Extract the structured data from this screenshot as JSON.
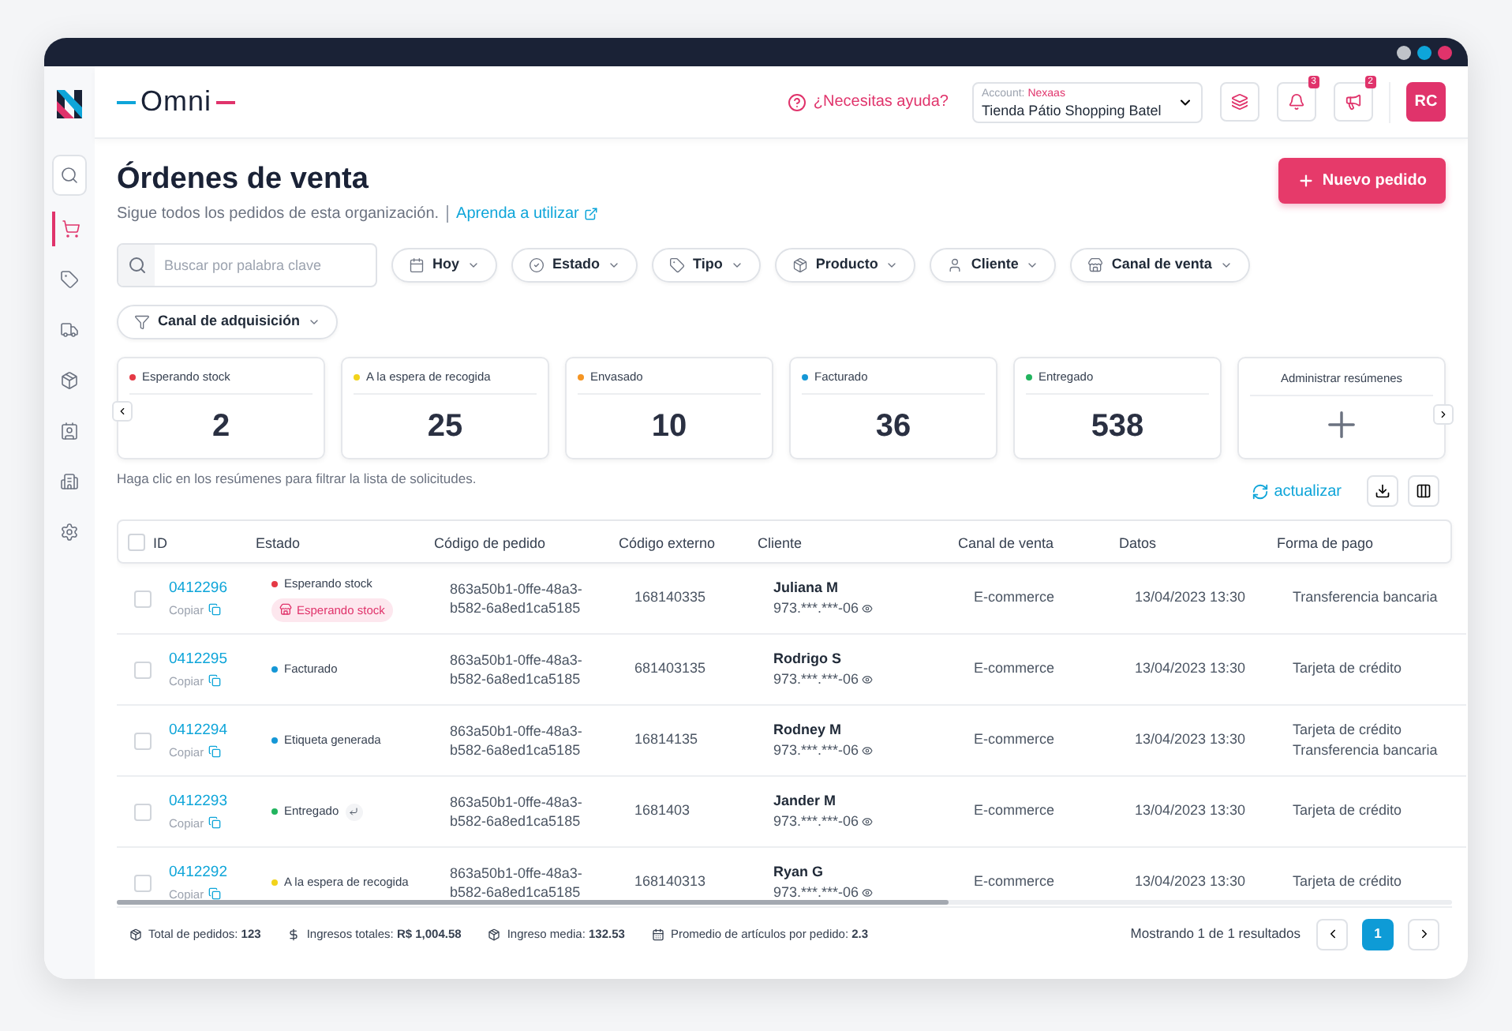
{
  "window": {
    "controls": [
      {
        "color": "#bfc3c9"
      },
      {
        "color": "#0ea5d9"
      },
      {
        "color": "#e0336b"
      }
    ]
  },
  "sidebar": {
    "items": [
      {
        "kind": "search",
        "selected": false
      },
      {
        "kind": "cart",
        "selected": true
      },
      {
        "kind": "tag",
        "selected": false
      },
      {
        "kind": "truck",
        "selected": false
      },
      {
        "kind": "box",
        "selected": false
      },
      {
        "kind": "contact",
        "selected": false
      },
      {
        "kind": "building",
        "selected": false
      },
      {
        "kind": "settings",
        "selected": false
      }
    ]
  },
  "header": {
    "brand": "Omni",
    "help": "¿Necesitas ayuda?",
    "account": {
      "label": "Account:",
      "name": "Nexaas",
      "store": "Tienda Pátio Shopping Batel"
    },
    "icons": [
      {
        "kind": "layers"
      },
      {
        "kind": "bell",
        "badge": "3"
      },
      {
        "kind": "megaphone",
        "badge": "2"
      }
    ],
    "avatar": "RC"
  },
  "page": {
    "title": "Órdenes de venta",
    "subtitle": "Sigue todos los pedidos de esta organización.",
    "learn_link": "Aprenda a utilizar",
    "new_button": "Nuevo pedido"
  },
  "search": {
    "placeholder": "Buscar por palabra clave"
  },
  "filters": [
    {
      "kind": "calendar",
      "label": "Hoy"
    },
    {
      "kind": "status",
      "label": "Estado"
    },
    {
      "kind": "tag",
      "label": "Tipo"
    },
    {
      "kind": "box",
      "label": "Producto"
    },
    {
      "kind": "user",
      "label": "Cliente"
    },
    {
      "kind": "store",
      "label": "Canal de venta"
    },
    {
      "kind": "funnel",
      "label": "Canal de adquisición"
    }
  ],
  "summaries": [
    {
      "label": "Esperando stock",
      "value": "2",
      "color": "#e53945"
    },
    {
      "label": "A la espera de recogida",
      "value": "25",
      "color": "#f2d31b"
    },
    {
      "label": "Envasado",
      "value": "10",
      "color": "#f59523"
    },
    {
      "label": "Facturado",
      "value": "36",
      "color": "#1597d6"
    },
    {
      "label": "Entregado",
      "value": "538",
      "color": "#22b45e"
    }
  ],
  "manage_summaries": "Administrar resúmenes",
  "hint": "Haga clic en los resúmenes para filtrar la lista de solicitudes.",
  "refresh": "actualizar",
  "table": {
    "all_checked": false,
    "columns": [
      "ID",
      "Estado",
      "Código de pedido",
      "Código externo",
      "Cliente",
      "Canal de venta",
      "Datos",
      "Forma de pago"
    ],
    "rows": [
      {
        "checked": false,
        "id": "0412296",
        "copy": "Copiar",
        "status": "Esperando stock",
        "color": "#e53945",
        "tag": "Esperando stock",
        "returned": false,
        "order_code": "863a50b1-0ffe-48a3-b582-6a8ed1ca5185",
        "external": "168140335",
        "client": "Juliana M",
        "doc": "973.***.***-06",
        "channel": "E-commerce",
        "date": "13/04/2023 13:30",
        "payment": [
          "Transferencia bancaria"
        ]
      },
      {
        "checked": false,
        "id": "0412295",
        "copy": "Copiar",
        "status": "Facturado",
        "color": "#1597d6",
        "returned": false,
        "order_code": "863a50b1-0ffe-48a3-b582-6a8ed1ca5185",
        "external": "681403135",
        "client": "Rodrigo S",
        "doc": "973.***.***-06",
        "channel": "E-commerce",
        "date": "13/04/2023 13:30",
        "payment": [
          "Tarjeta de crédito"
        ]
      },
      {
        "checked": false,
        "id": "0412294",
        "copy": "Copiar",
        "status": "Etiqueta generada",
        "color": "#1597d6",
        "returned": false,
        "order_code": "863a50b1-0ffe-48a3-b582-6a8ed1ca5185",
        "external": "16814135",
        "client": "Rodney M",
        "doc": "973.***.***-06",
        "channel": "E-commerce",
        "date": "13/04/2023 13:30",
        "payment": [
          "Tarjeta de crédito",
          "Transferencia bancaria"
        ]
      },
      {
        "checked": false,
        "id": "0412293",
        "copy": "Copiar",
        "status": "Entregado",
        "color": "#22b45e",
        "returned": true,
        "order_code": "863a50b1-0ffe-48a3-b582-6a8ed1ca5185",
        "external": "1681403",
        "client": "Jander M",
        "doc": "973.***.***-06",
        "channel": "E-commerce",
        "date": "13/04/2023 13:30",
        "payment": [
          "Tarjeta de crédito"
        ]
      },
      {
        "checked": false,
        "id": "0412292",
        "copy": "Copiar",
        "status": "A la espera de recogida",
        "color": "#f2d31b",
        "returned": false,
        "order_code": "863a50b1-0ffe-48a3-b582-6a8ed1ca5185",
        "external": "168140313",
        "client": "Ryan G",
        "doc": "973.***.***-06",
        "channel": "E-commerce",
        "date": "13/04/2023 13:30",
        "payment": [
          "Tarjeta de crédito"
        ]
      }
    ]
  },
  "stats": [
    {
      "kind": "box",
      "text": "Total de pedidos: **123**"
    },
    {
      "kind": "dollar",
      "text": "Ingresos totales: **R$ 1,004.58**"
    },
    {
      "kind": "box",
      "text": "Ingreso media: **132.53**"
    },
    {
      "kind": "calendar",
      "text": "Promedio de artículos por pedido: **2.3**"
    }
  ],
  "pagination": {
    "summary": "Mostrando 1 de 1 resultados",
    "pages": [
      {
        "label": "1",
        "selected": true
      }
    ]
  }
}
